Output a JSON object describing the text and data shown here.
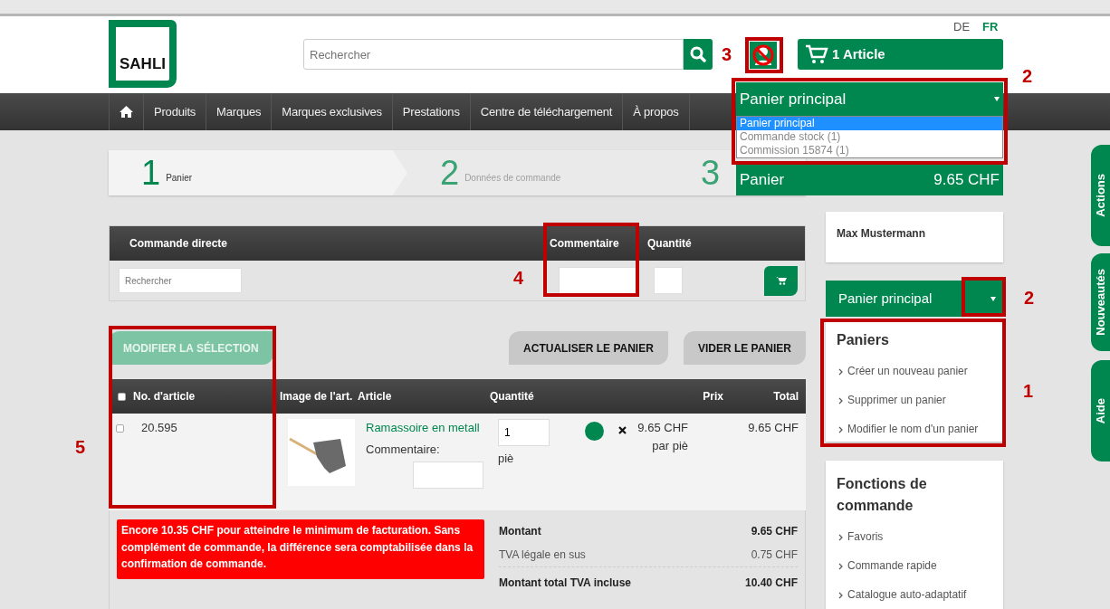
{
  "languages": [
    {
      "label": "DE",
      "selected": false
    },
    {
      "label": "FR",
      "selected": true
    }
  ],
  "logo": {
    "text": "SAHLI"
  },
  "search": {
    "placeholder": "Rechercher"
  },
  "cart_button": {
    "label": "1 Article"
  },
  "nav": [
    {
      "label": "Produits"
    },
    {
      "label": "Marques"
    },
    {
      "label": "Marques exclusives"
    },
    {
      "label": "Prestations"
    },
    {
      "label": "Centre de téléchargement"
    },
    {
      "label": "À propos"
    }
  ],
  "cart_dropdown": {
    "value": "Panier principal",
    "options": [
      {
        "label": "Panier principal",
        "selected": true
      },
      {
        "label": "Commande stock (1)",
        "selected": false
      },
      {
        "label": "Commission 15874 (1)",
        "selected": false
      }
    ]
  },
  "cart_total": {
    "label": "Panier",
    "amount": "9.65 CHF"
  },
  "steps": [
    {
      "number": "1",
      "label": "Panier",
      "selected": true
    },
    {
      "number": "2",
      "label": "Données de commande",
      "selected": false
    },
    {
      "number": "3",
      "selected": false
    }
  ],
  "direct_order": {
    "title": "Commande directe",
    "comment_label": "Commentaire",
    "quantity_label": "Quantité",
    "search_placeholder": "Rechercher"
  },
  "buttons": [
    {
      "label": "MODIFIER LA SÉLECTION",
      "disabled": true
    },
    {
      "label": "ACTUALISER LE PANIER",
      "disabled": false
    },
    {
      "label": "VIDER LE PANIER",
      "disabled": false
    }
  ],
  "table": {
    "select_all_checked": false,
    "columns": [
      "No. d'article",
      "Image de l'art.",
      "Article",
      "Quantité",
      "Prix",
      "Total"
    ],
    "rows": [
      {
        "checked": false,
        "number": "20.595",
        "article": "Ramassoire en metall",
        "comment_label": "Commentaire:",
        "quantity": "1",
        "unit": "piè",
        "color": "#00874f",
        "price": "9.65 CHF",
        "price_unit": "par piè",
        "total": "9.65 CHF"
      }
    ]
  },
  "warning": "Encore 10.35 CHF pour atteindre le minimum de facturation. Sans complément de commande, la différence sera comptabilisée dans la confirmation de commande.",
  "summary": [
    {
      "label": "Montant",
      "value": "9.65 CHF",
      "bold": true
    },
    {
      "label": "TVA légale en sus",
      "value": "0.75 CHF",
      "bold": false
    },
    {
      "label": "Montant total TVA incluse",
      "value": "10.40 CHF",
      "bold": true
    }
  ],
  "sidebar": {
    "user": "Max Mustermann",
    "cart_select": "Panier principal",
    "carts": {
      "title": "Paniers",
      "links": [
        "Créer un nouveau panier",
        "Supprimer un panier",
        "Modifier le nom d'un panier"
      ]
    },
    "functions": {
      "title": "Fonctions de commande",
      "links": [
        "Favoris",
        "Commande rapide",
        "Catalogue auto-adaptatif"
      ]
    }
  },
  "side_tabs": [
    "Actions",
    "Nouveautés",
    "Aide"
  ],
  "annotations": [
    {
      "number": "3"
    },
    {
      "number": "2"
    },
    {
      "number": "4"
    },
    {
      "number": "5"
    },
    {
      "number": "2"
    },
    {
      "number": "1"
    }
  ]
}
